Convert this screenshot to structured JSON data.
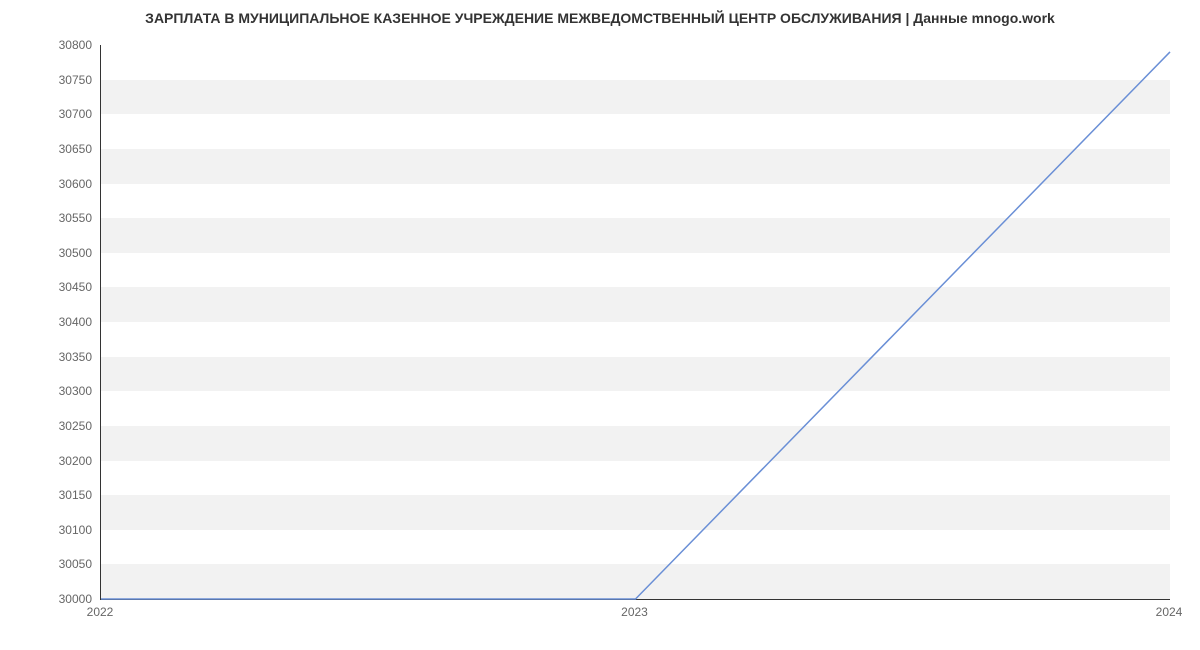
{
  "chart_data": {
    "type": "line",
    "title": "ЗАРПЛАТА В МУНИЦИПАЛЬНОЕ КАЗЕННОЕ УЧРЕЖДЕНИЕ МЕЖВЕДОМСТВЕННЫЙ ЦЕНТР ОБСЛУЖИВАНИЯ | Данные mnogo.work",
    "x": [
      2022,
      2023,
      2024
    ],
    "series": [
      {
        "name": "Зарплата",
        "values": [
          30000,
          30000,
          30790
        ]
      }
    ],
    "xlabel": "",
    "ylabel": "",
    "x_ticks": [
      2022,
      2023,
      2024
    ],
    "y_ticks": [
      30000,
      30050,
      30100,
      30150,
      30200,
      30250,
      30300,
      30350,
      30400,
      30450,
      30500,
      30550,
      30600,
      30650,
      30700,
      30750,
      30800
    ],
    "xlim": [
      2022,
      2024
    ],
    "ylim": [
      30000,
      30800
    ],
    "line_color": "#6a8fd6",
    "band_color": "#f2f2f2"
  }
}
